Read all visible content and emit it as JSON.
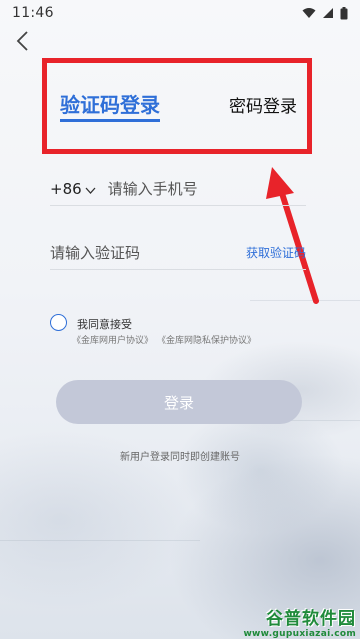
{
  "status_bar": {
    "time": "11:46"
  },
  "tabs": {
    "active_label": "验证码登录",
    "inactive_label": "密码登录"
  },
  "phone": {
    "country_code": "+86",
    "placeholder": "请输入手机号"
  },
  "code": {
    "placeholder": "请输入验证码",
    "get_code_label": "获取验证码"
  },
  "agreement": {
    "text": "我同意接受",
    "link_user": "《金库网用户协议》",
    "link_privacy": "《金库网隐私保护协议》"
  },
  "login_button": "登录",
  "note": "新用户登录同时即创建账号",
  "watermark": {
    "title": "谷普软件园",
    "url": "www.gupuxiazai.com"
  },
  "colors": {
    "accent": "#2f6fd8",
    "annotation": "#e8232a",
    "button_disabled": "#c3c8d8"
  },
  "icons": [
    "back-arrow-icon",
    "wifi-icon",
    "signal-icon",
    "battery-icon",
    "chevron-down-icon",
    "annotation-arrow-icon"
  ]
}
